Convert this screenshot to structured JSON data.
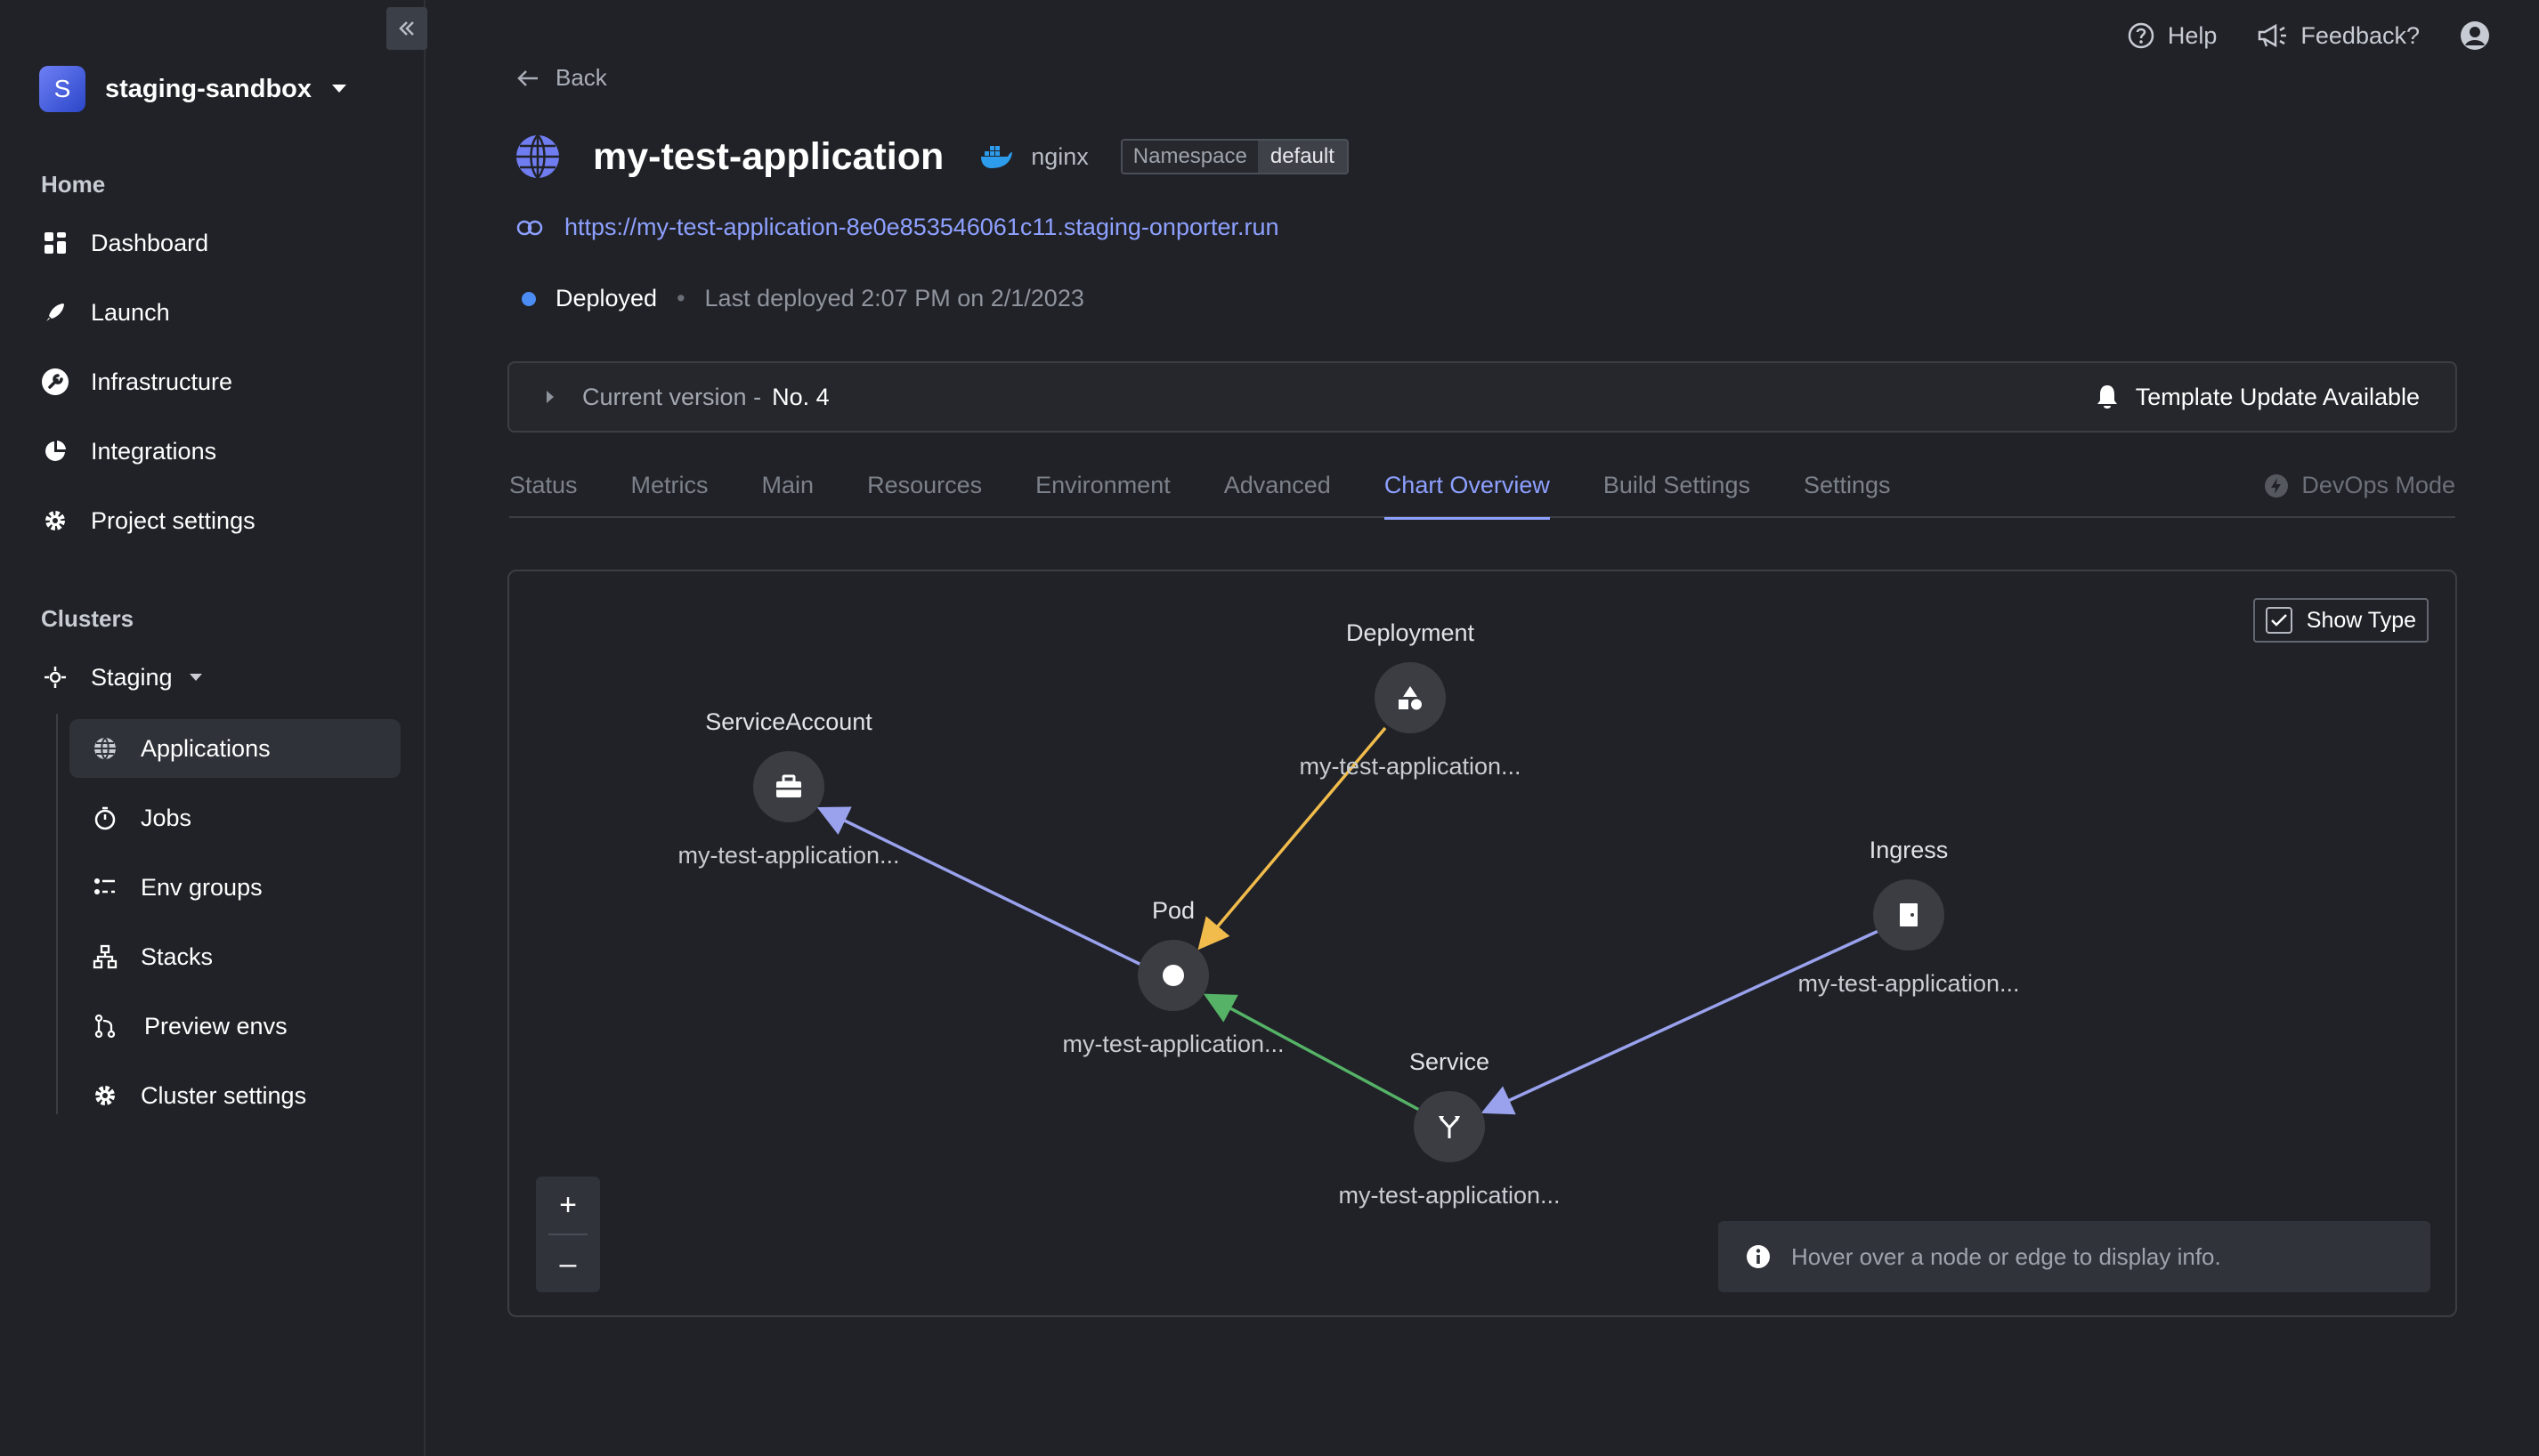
{
  "sidebar": {
    "project_initial": "S",
    "project_name": "staging-sandbox",
    "home_heading": "Home",
    "home_items": [
      {
        "label": "Dashboard",
        "icon": "grid-icon"
      },
      {
        "label": "Launch",
        "icon": "rocket-icon"
      },
      {
        "label": "Infrastructure",
        "icon": "wrench-icon"
      },
      {
        "label": "Integrations",
        "icon": "pie-icon"
      },
      {
        "label": "Project settings",
        "icon": "gear-icon"
      }
    ],
    "clusters_heading": "Clusters",
    "cluster_name": "Staging",
    "cluster_items": [
      {
        "label": "Applications",
        "icon": "globe-icon",
        "active": true
      },
      {
        "label": "Jobs",
        "icon": "timer-icon"
      },
      {
        "label": "Env groups",
        "icon": "env-icon"
      },
      {
        "label": "Stacks",
        "icon": "stacks-icon"
      },
      {
        "label": "Preview envs",
        "icon": "branch-icon"
      },
      {
        "label": "Cluster settings",
        "icon": "gear-icon"
      }
    ]
  },
  "topbar": {
    "help": "Help",
    "feedback": "Feedback?"
  },
  "header": {
    "back": "Back",
    "app_name": "my-test-application",
    "image": "nginx",
    "namespace_key": "Namespace",
    "namespace_value": "default",
    "url": "https://my-test-application-8e0e853546061c11.staging-onporter.run",
    "status": "Deployed",
    "status_sep": "•",
    "last_deployed": "Last deployed 2:07 PM on 2/1/2023"
  },
  "version_bar": {
    "label": "Current version -",
    "number": "No. 4",
    "template_update": "Template Update Available"
  },
  "tabs": [
    "Status",
    "Metrics",
    "Main",
    "Resources",
    "Environment",
    "Advanced",
    "Chart Overview",
    "Build Settings",
    "Settings"
  ],
  "active_tab": "Chart Overview",
  "devops_mode": "DevOps Mode",
  "graph": {
    "show_type_label": "Show Type",
    "show_type_checked": true,
    "zoom_in": "+",
    "zoom_out": "–",
    "hover_info": "Hover over a node or edge to display info.",
    "nodes": [
      {
        "type": "ServiceAccount",
        "name": "my-test-application...",
        "icon": "briefcase-icon"
      },
      {
        "type": "Deployment",
        "name": "my-test-application...",
        "icon": "shapes-icon"
      },
      {
        "type": "Pod",
        "name": "my-test-application...",
        "icon": "dot-icon"
      },
      {
        "type": "Ingress",
        "name": "my-test-application...",
        "icon": "door-icon"
      },
      {
        "type": "Service",
        "name": "my-test-application...",
        "icon": "fork-icon"
      }
    ],
    "edge_colors": {
      "blue": "#9aa2ee",
      "yellow": "#f1bc4c",
      "green": "#55b266"
    }
  },
  "colors": {
    "background": "#202227",
    "accent": "#8ea0ff",
    "status_blue": "#4b8cf5"
  }
}
